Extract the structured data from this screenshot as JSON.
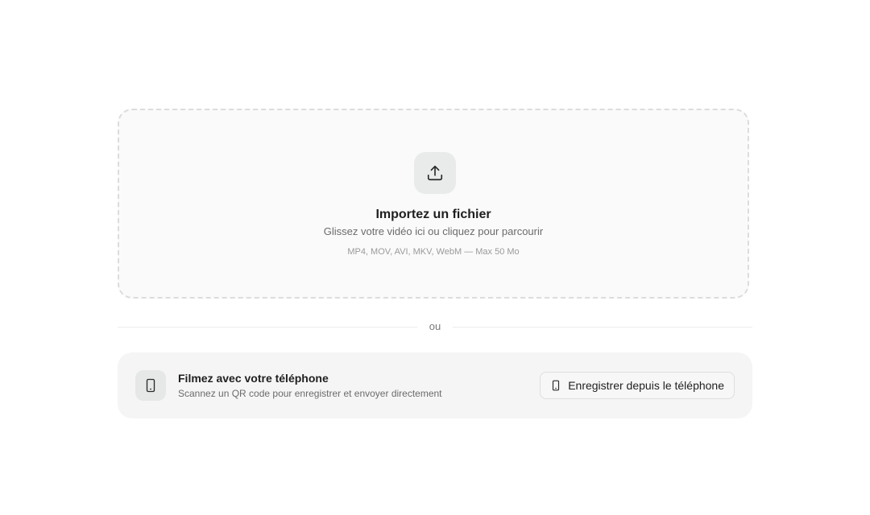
{
  "upload": {
    "icon": "upload-icon",
    "title": "Importez un fichier",
    "subtitle": "Glissez votre vidéo ici ou cliquez pour parcourir",
    "formats": "MP4, MOV, AVI, MKV, WebM — Max 50 Mo"
  },
  "divider": {
    "label": "ou"
  },
  "phone": {
    "icon": "smartphone-icon",
    "title": "Filmez avec votre téléphone",
    "subtitle": "Scannez un QR code pour enregistrer et envoyer directement",
    "button_label": "Enregistrer depuis le téléphone",
    "button_icon": "smartphone-icon"
  },
  "colors": {
    "text": "#1f1f1f",
    "muted": "#6b6b6b",
    "dashed_border": "#dcdcdc",
    "card_bg": "#f5f5f5"
  }
}
